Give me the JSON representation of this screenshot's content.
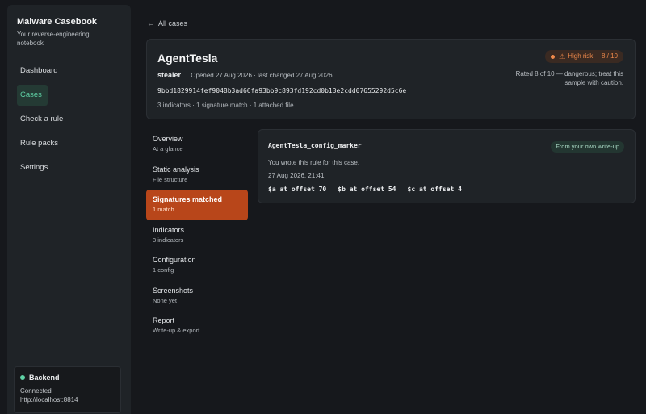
{
  "sidebar": {
    "brand_title": "Malware Casebook",
    "brand_subtitle": "Your reverse-engineering notebook",
    "nav": [
      {
        "label": "Dashboard",
        "active": false
      },
      {
        "label": "Cases",
        "active": true
      },
      {
        "label": "Check a rule",
        "active": false
      },
      {
        "label": "Rule packs",
        "active": false
      },
      {
        "label": "Settings",
        "active": false
      }
    ],
    "backend": {
      "label": "Backend",
      "status": "Connected · http://localhost:8814",
      "status_color": "#5fd1a5"
    }
  },
  "main": {
    "back_link": "All cases",
    "case": {
      "title": "AgentTesla",
      "type": "stealer",
      "opened": "Opened 27 Aug 2026 · last changed 27 Aug 2026",
      "hash": "9bbd1829914fef9048b3ad66fa93bb9c893fd192cd0b13e2cdd07655292d5c6e",
      "summary": "3 indicators · 1 signature match · 1 attached file",
      "risk_label": "High risk",
      "risk_score": "8 / 10",
      "risk_color": "#f08a4b",
      "risk_note": "Rated 8 of 10 — dangerous; treat this sample with caution."
    },
    "tabs": [
      {
        "label": "Overview",
        "sub": "At a glance",
        "active": false
      },
      {
        "label": "Static analysis",
        "sub": "File structure",
        "active": false
      },
      {
        "label": "Signatures matched",
        "sub": "1 match",
        "active": true
      },
      {
        "label": "Indicators",
        "sub": "3 indicators",
        "active": false
      },
      {
        "label": "Configuration",
        "sub": "1 config",
        "active": false
      },
      {
        "label": "Screenshots",
        "sub": "None yet",
        "active": false
      },
      {
        "label": "Report",
        "sub": "Write-up & export",
        "active": false
      }
    ],
    "match": {
      "rule_name": "AgentTesla_config_marker",
      "source_badge": "From your own write-up",
      "note": "You wrote this rule for this case.",
      "time": "27 Aug 2026, 21:41",
      "offsets": [
        "$a at offset 70",
        "$b at offset 54",
        "$c at offset 4"
      ]
    }
  }
}
